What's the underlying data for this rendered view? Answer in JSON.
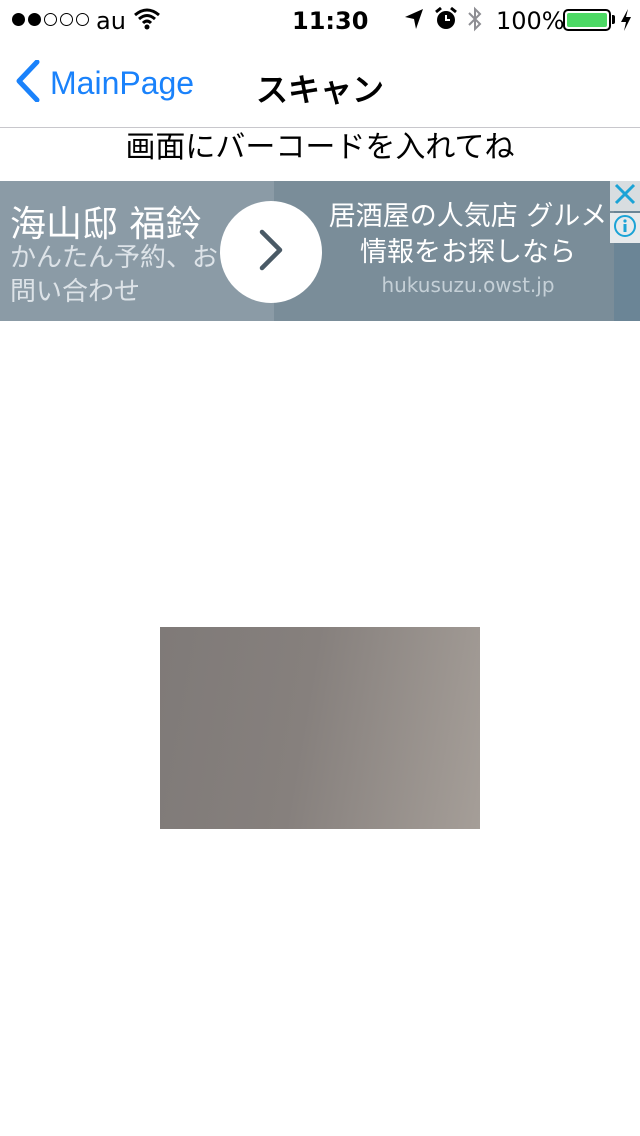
{
  "status_bar": {
    "carrier": "au",
    "time": "11:30",
    "battery_percent": "100%",
    "signal_strength": "2 of 5 dots",
    "battery_level": 1.0,
    "battery_color": "#4cd964"
  },
  "nav": {
    "back_label": "MainPage",
    "title": "スキャン",
    "accent_color": "#1a82fb"
  },
  "instruction": "画面にバーコードを入れてね",
  "ad": {
    "headline": "海山邸 福鈴",
    "subtext": "かんたん予約、お問い合わせ",
    "description": "居酒屋の人気店 グルメ情報をお探しなら",
    "url": "hukusuzu.owst.jp",
    "arrow_icon": "chevron-right-icon",
    "close_icon": "close-icon",
    "info_icon": "info-icon"
  },
  "camera": {
    "preview_icon": "camera-preview"
  }
}
